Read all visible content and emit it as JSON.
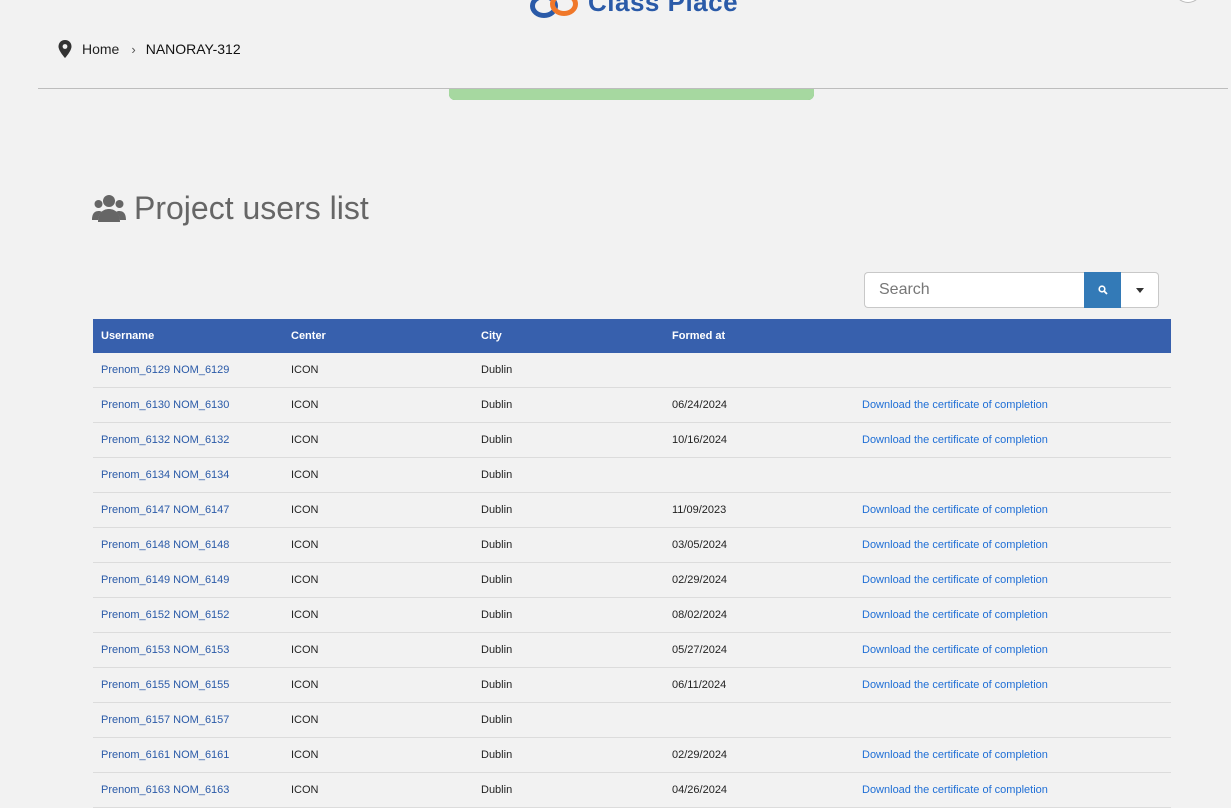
{
  "header": {
    "logo_text": "Class Place"
  },
  "breadcrumb": {
    "home_label": "Home",
    "separator": "›",
    "current": "NANORAY-312"
  },
  "progress": {
    "value": 1.0
  },
  "page": {
    "title": "Project users list"
  },
  "search": {
    "placeholder": "Search"
  },
  "table": {
    "columns": [
      "Username",
      "Center",
      "City",
      "Formed at",
      ""
    ],
    "rows": [
      {
        "username": "Prenom_6129 NOM_6129",
        "center": "ICON",
        "city": "Dublin",
        "formed_at": "",
        "action": ""
      },
      {
        "username": "Prenom_6130 NOM_6130",
        "center": "ICON",
        "city": "Dublin",
        "formed_at": "06/24/2024",
        "action": "Download the certificate of completion"
      },
      {
        "username": "Prenom_6132 NOM_6132",
        "center": "ICON",
        "city": "Dublin",
        "formed_at": "10/16/2024",
        "action": "Download the certificate of completion"
      },
      {
        "username": "Prenom_6134 NOM_6134",
        "center": "ICON",
        "city": "Dublin",
        "formed_at": "",
        "action": ""
      },
      {
        "username": "Prenom_6147 NOM_6147",
        "center": "ICON",
        "city": "Dublin",
        "formed_at": "11/09/2023",
        "action": "Download the certificate of completion"
      },
      {
        "username": "Prenom_6148 NOM_6148",
        "center": "ICON",
        "city": "Dublin",
        "formed_at": "03/05/2024",
        "action": "Download the certificate of completion"
      },
      {
        "username": "Prenom_6149 NOM_6149",
        "center": "ICON",
        "city": "Dublin",
        "formed_at": "02/29/2024",
        "action": "Download the certificate of completion"
      },
      {
        "username": "Prenom_6152 NOM_6152",
        "center": "ICON",
        "city": "Dublin",
        "formed_at": "08/02/2024",
        "action": "Download the certificate of completion"
      },
      {
        "username": "Prenom_6153 NOM_6153",
        "center": "ICON",
        "city": "Dublin",
        "formed_at": "05/27/2024",
        "action": "Download the certificate of completion"
      },
      {
        "username": "Prenom_6155 NOM_6155",
        "center": "ICON",
        "city": "Dublin",
        "formed_at": "06/11/2024",
        "action": "Download the certificate of completion"
      },
      {
        "username": "Prenom_6157 NOM_6157",
        "center": "ICON",
        "city": "Dublin",
        "formed_at": "",
        "action": ""
      },
      {
        "username": "Prenom_6161 NOM_6161",
        "center": "ICON",
        "city": "Dublin",
        "formed_at": "02/29/2024",
        "action": "Download the certificate of completion"
      },
      {
        "username": "Prenom_6163 NOM_6163",
        "center": "ICON",
        "city": "Dublin",
        "formed_at": "04/26/2024",
        "action": "Download the certificate of completion"
      }
    ]
  },
  "colors": {
    "header_bg": "#3760ad",
    "link": "#2a5aa8",
    "search_button": "#337ab7",
    "progress": "#9fd39a"
  },
  "icons": [
    "map-pin-icon",
    "users-icon",
    "search-icon",
    "caret-down-icon"
  ]
}
